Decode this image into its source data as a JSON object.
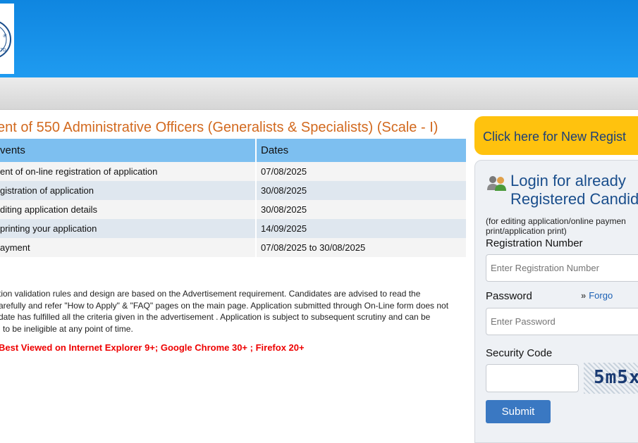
{
  "header": {
    "colors": {
      "bar": "#1f9bf0"
    },
    "logo_icon": "bank-seal-logo"
  },
  "page": {
    "title": "ent of 550 Administrative Officers (Generalists & Specialists) (Scale - I)"
  },
  "events_table": {
    "headers": [
      "vents",
      "Dates"
    ],
    "rows": [
      [
        "ent of on-line registration of application",
        "07/08/2025"
      ],
      [
        "gistration of application",
        "30/08/2025"
      ],
      [
        "diting application details",
        "30/08/2025"
      ],
      [
        "printing your application",
        "14/09/2025"
      ],
      [
        "ayment",
        "07/08/2025 to 30/08/2025"
      ]
    ]
  },
  "note_lines": [
    "tion validation rules and design are based on the Advertisement requirement. Candidates are advised to read the",
    "arefully and refer \"How to Apply\" & \"FAQ\" pages on the main page. Application submitted through On-Line form does not",
    "date has fulfilled all the criteria given in the advertisement . Application is subject to subsequent scrutiny and can be",
    "l to be ineligible at any point of time."
  ],
  "browser_note": "Best Viewed on Internet Explorer 9+; Google Chrome 30+ ; Firefox 20+",
  "new_registration": {
    "label": "Click here for New Regist",
    "color": "#ffc20e"
  },
  "login": {
    "title_line1": "Login for already",
    "title_line2": "Registered Candid",
    "subtitle_line1": "(for editing application/online paymen",
    "subtitle_line2": "print/application print)",
    "reg_label": "Registration Number",
    "reg_placeholder": "Enter Registration Number",
    "password_label": "Password",
    "forgot_label": "Forgo",
    "password_placeholder": "Enter Password",
    "security_label": "Security Code",
    "captcha_text": "5m5x",
    "submit_label": "Submit"
  }
}
